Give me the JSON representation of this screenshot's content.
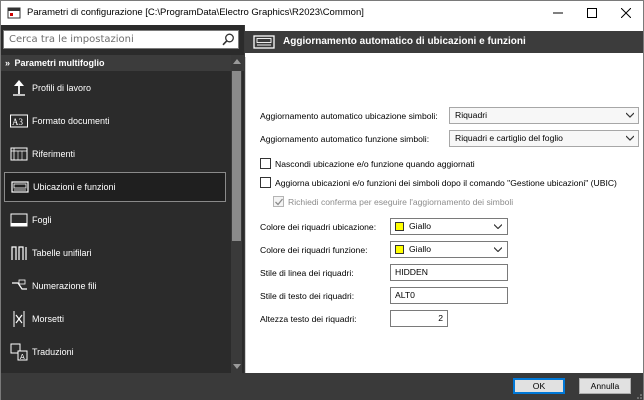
{
  "window": {
    "title": "Parametri di configurazione [C:\\ProgramData\\Electro Graphics\\R2023\\Common]",
    "minimize_icon": "minimize-icon",
    "maximize_icon": "maximize-icon",
    "close_icon": "close-icon"
  },
  "search": {
    "placeholder": "Cerca tra le impostazioni",
    "icon": "search-icon"
  },
  "sidebar": {
    "group_label": "Parametri multifoglio",
    "items": [
      {
        "label": "Profili di lavoro",
        "icon": "up-arrow-icon",
        "selected": false
      },
      {
        "label": "Formato documenti",
        "icon": "a3-icon",
        "selected": false
      },
      {
        "label": "Riferimenti",
        "icon": "grid-icon",
        "selected": false
      },
      {
        "label": "Ubicazioni e funzioni",
        "icon": "monitor-icon",
        "selected": true
      },
      {
        "label": "Fogli",
        "icon": "sheet-icon",
        "selected": false
      },
      {
        "label": "Tabelle unifilari",
        "icon": "unifilar-icon",
        "selected": false
      },
      {
        "label": "Numerazione fili",
        "icon": "wire-numbering-icon",
        "selected": false
      },
      {
        "label": "Morsetti",
        "icon": "terminal-icon",
        "selected": false
      },
      {
        "label": "Traduzioni",
        "icon": "translate-icon",
        "selected": false
      }
    ]
  },
  "section": {
    "title": "Aggiornamento automatico di ubicazioni e funzioni"
  },
  "form": {
    "location_update_label": "Aggiornamento automatico ubicazione simboli:",
    "location_update_value": "Riquadri",
    "function_update_label": "Aggiornamento automatico funzione simboli:",
    "function_update_value": "Riquadri e cartiglio del foglio",
    "hide_label": "Nascondi ubicazione e/o funzione quando aggiornati",
    "hide_checked": false,
    "update_after_label": "Aggiorna ubicazioni e/o funzioni dei simboli dopo il comando \"Gestione ubicazioni\" (UBIC)",
    "update_after_checked": false,
    "confirm_label": "Richiedi conferma per eseguire l'aggiornamento dei simboli",
    "confirm_checked": true,
    "location_color_label": "Colore dei riquadri ubicazione:",
    "location_color_value": "Giallo",
    "function_color_label": "Colore dei riquadri funzione:",
    "function_color_value": "Giallo",
    "swatch_color": "#ffff00",
    "line_style_label": "Stile di linea dei riquadri:",
    "line_style_value": "HIDDEN",
    "text_style_label": "Stile di testo dei riquadri:",
    "text_style_value": "ALT0",
    "text_height_label": "Altezza testo dei riquadri:",
    "text_height_value": "2"
  },
  "footer": {
    "ok_label": "OK",
    "cancel_label": "Annulla"
  },
  "colors": {
    "dark_bg": "#2b2b2b",
    "header_bg": "#3c3c3c",
    "accent": "#0078d7"
  }
}
